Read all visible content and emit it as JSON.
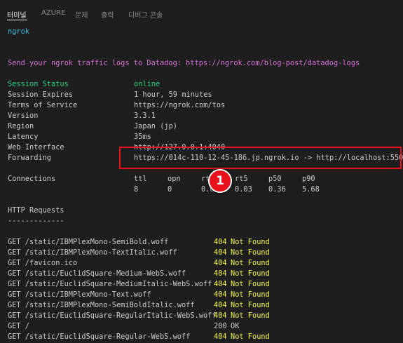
{
  "tabs": [
    {
      "label": "터미널",
      "active": true
    },
    {
      "label": "AZURE"
    },
    {
      "label": "문제"
    },
    {
      "label": "출력"
    },
    {
      "label": "디버그 콘솔"
    }
  ],
  "terminal": {
    "app_name": "ngrok",
    "promo": "Send your ngrok traffic logs to Datadog: https://ngrok.com/blog-post/datadog-logs",
    "session": [
      {
        "label": "Session Status",
        "value": "online"
      },
      {
        "label": "Session Expires",
        "value": "1 hour, 59 minutes"
      },
      {
        "label": "Terms of Service",
        "value": "https://ngrok.com/tos"
      },
      {
        "label": "Version",
        "value": "3.3.1"
      },
      {
        "label": "Region",
        "value": "Japan (jp)"
      },
      {
        "label": "Latency",
        "value": "35ms"
      },
      {
        "label": "Web Interface",
        "value": "http://127.0.0.1:4040"
      },
      {
        "label": "Forwarding",
        "value": "https://014c-110-12-45-186.jp.ngrok.io -> http://localhost:5500"
      }
    ],
    "connections": {
      "label": "Connections",
      "headers": [
        "ttl",
        "opn",
        "rt1",
        "rt5",
        "p50",
        "p90"
      ],
      "values": [
        "8",
        "0",
        "0.01",
        "0.03",
        "0.36",
        "5.68"
      ]
    },
    "http_title": "HTTP Requests",
    "http_rule": "-------------",
    "requests": [
      {
        "req": "GET /static/IBMPlexMono-SemiBold.woff",
        "code": "404",
        "status": "Not Found"
      },
      {
        "req": "GET /static/IBMPlexMono-TextItalic.woff",
        "code": "404",
        "status": "Not Found"
      },
      {
        "req": "GET /favicon.ico",
        "code": "404",
        "status": "Not Found"
      },
      {
        "req": "GET /static/EuclidSquare-Medium-WebS.woff",
        "code": "404",
        "status": "Not Found"
      },
      {
        "req": "GET /static/EuclidSquare-MediumItalic-WebS.woff",
        "code": "404",
        "status": "Not Found"
      },
      {
        "req": "GET /static/IBMPlexMono-Text.woff",
        "code": "404",
        "status": "Not Found"
      },
      {
        "req": "GET /static/IBMPlexMono-SemiBoldItalic.woff",
        "code": "404",
        "status": "Not Found"
      },
      {
        "req": "GET /static/EuclidSquare-RegularItalic-WebS.woff",
        "code": "404",
        "status": "Not Found"
      },
      {
        "req": "GET /",
        "code": "200",
        "status": "OK"
      },
      {
        "req": "GET /static/EuclidSquare-Regular-WebS.woff",
        "code": "404",
        "status": "Not Found"
      }
    ]
  },
  "annotation": {
    "badge_number": "1",
    "highlight_color": "#e8101a"
  },
  "colors": {
    "background": "#1e1e1e",
    "text": "#cccccc",
    "cyan": "#3fb6dd",
    "magenta": "#d670d6",
    "green": "#23d18b",
    "yellow": "#f5f543"
  }
}
